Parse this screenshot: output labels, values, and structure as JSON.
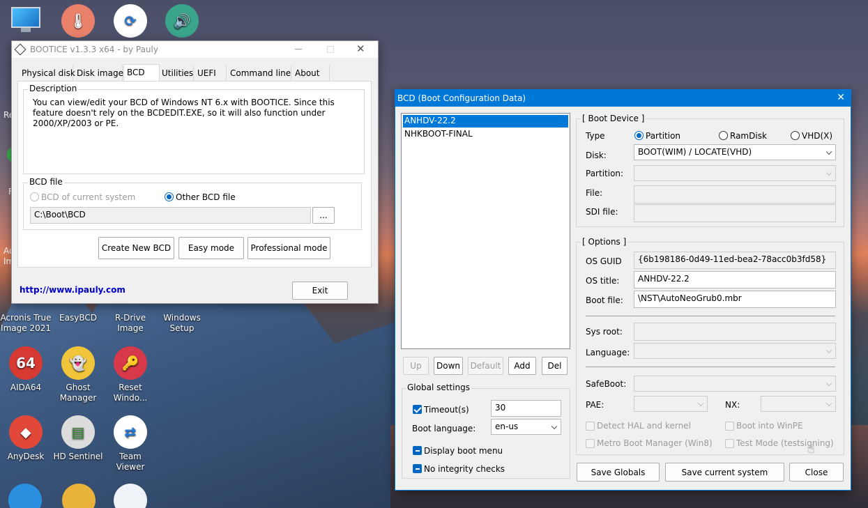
{
  "desktop": {
    "icons": [
      {
        "label": "",
        "color": "#3a8fd6"
      },
      {
        "label": "",
        "color": "#e8806a"
      },
      {
        "label": "",
        "color": "#2a7ad6"
      },
      {
        "label": "",
        "color": "#3aa58a"
      },
      {
        "label": "Acronis True Image 2021",
        "color": "#2b6fb0"
      },
      {
        "label": "EasyBCD",
        "color": "#3f7fc0"
      },
      {
        "label": "R-Drive Image",
        "color": "#2e6dbb"
      },
      {
        "label": "Windows Setup",
        "color": "#d55f3a"
      },
      {
        "label": "AIDA64",
        "color": "#d63a33",
        "glyph": "64"
      },
      {
        "label": "Ghost Manager",
        "color": "#f0c53a"
      },
      {
        "label": "Reset Windo...",
        "color": "#d8394a"
      },
      {
        "label": "AnyDesk",
        "color": "#e2483a"
      },
      {
        "label": "HD Sentinel",
        "color": "#6aa86a"
      },
      {
        "label": "Team Viewer",
        "color": "#1f7ad6"
      }
    ],
    "edge_fragments": [
      "Re",
      "F",
      "Ac",
      "Im"
    ]
  },
  "bootice": {
    "title": "BOOTICE v1.3.3 x64 - by Pauly",
    "tabs": [
      "Physical disk",
      "Disk  image",
      "BCD",
      "Utilities",
      "UEFI",
      "Command line",
      "About"
    ],
    "active_tab": "BCD",
    "description_label": "Description",
    "description_text": "You can view/edit your BCD of Windows NT 6.x with BOOTICE. Since this feature doesn't rely on the BCDEDIT.EXE, so it will also function under 2000/XP/2003 or PE.",
    "bcd_file_label": "BCD file",
    "radio_current": "BCD of current system",
    "radio_other": "Other BCD file",
    "bcd_path": "C:\\Boot\\BCD",
    "browse_label": "...",
    "btn_create": "Create New BCD",
    "btn_easy": "Easy mode",
    "btn_pro": "Professional mode",
    "link": "http://www.ipauly.com",
    "btn_exit": "Exit"
  },
  "bcd": {
    "title": "BCD (Boot Configuration Data)",
    "entries": [
      "ANHDV-22.2",
      "NHKBOOT-FINAL"
    ],
    "btn_up": "Up",
    "btn_down": "Down",
    "btn_default": "Default",
    "btn_add": "Add",
    "btn_del": "Del",
    "global_label": "Global settings",
    "timeout_label": "Timeout(s)",
    "timeout_value": "30",
    "boot_lang_label": "Boot language:",
    "boot_lang_value": "en-us",
    "display_menu": "Display boot menu",
    "no_integrity": "No integrity checks",
    "boot_device_label": "[ Boot Device ]",
    "type_label": "Type",
    "type_partition": "Partition",
    "type_ramdisk": "RamDisk",
    "type_vhd": "VHD(X)",
    "disk_label": "Disk:",
    "disk_value": "BOOT(WIM) / LOCATE(VHD)",
    "partition_label": "Partition:",
    "file_label": "File:",
    "sdi_label": "SDI file:",
    "options_label": "[ Options ]",
    "os_guid_label": "OS GUID",
    "os_guid_value": "{6b198186-0d49-11ed-bea2-78acc0b3fd58}",
    "os_title_label": "OS title:",
    "os_title_value": "ANHDV-22.2",
    "boot_file_label": "Boot file:",
    "boot_file_value": "\\NST\\AutoNeoGrub0.mbr",
    "sys_root_label": "Sys root:",
    "language_label": "Language:",
    "safeboot_label": "SafeBoot:",
    "pae_label": "PAE:",
    "nx_label": "NX:",
    "detect_hal": "Detect HAL and kernel",
    "boot_winpe": "Boot into WinPE",
    "metro": "Metro Boot Manager (Win8)",
    "test_mode": "Test Mode (testsigning)",
    "btn_save_globals": "Save Globals",
    "btn_save_current": "Save current system",
    "btn_close": "Close"
  },
  "colors": {
    "accent": "#0078d7",
    "selection": "#0078d7",
    "link": "#0000cc"
  }
}
